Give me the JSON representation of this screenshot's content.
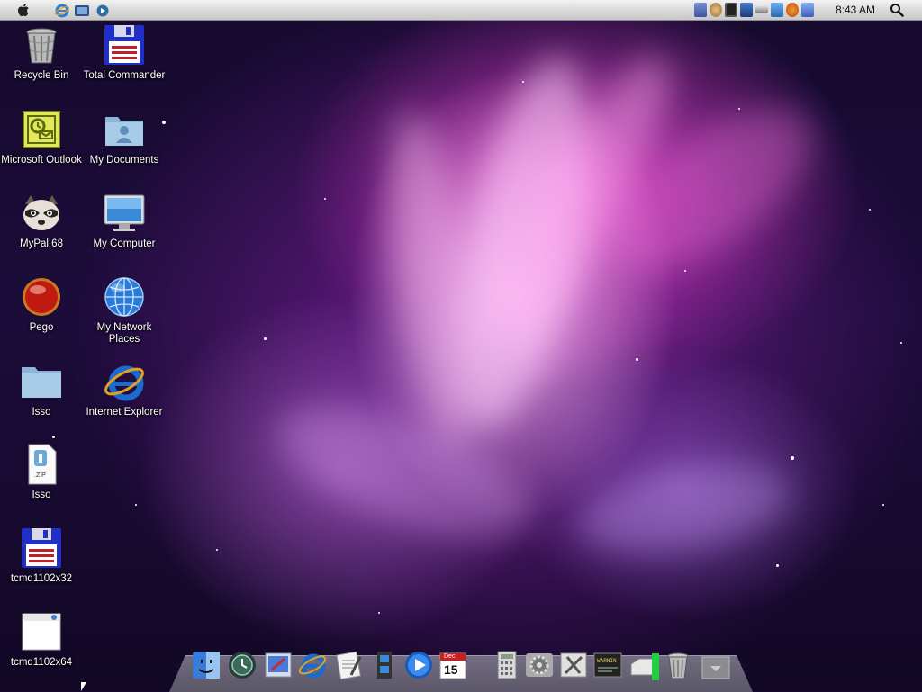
{
  "menubar": {
    "apple": "",
    "clock": "8:43 AM"
  },
  "desktop": {
    "icons": [
      {
        "label": "Recycle Bin",
        "icon": "trash-icon"
      },
      {
        "label": "Total Commander",
        "icon": "floppy-icon"
      },
      {
        "label": "Microsoft Outlook",
        "icon": "outlook-icon"
      },
      {
        "label": "My Documents",
        "icon": "user-folder-icon"
      },
      {
        "label": "MyPal 68",
        "icon": "raccoon-icon"
      },
      {
        "label": "My Computer",
        "icon": "monitor-icon"
      },
      {
        "label": "Pego",
        "icon": "red-orb-icon"
      },
      {
        "label": "My Network Places",
        "icon": "globe-icon"
      },
      {
        "label": "Isso",
        "icon": "folder-icon"
      },
      {
        "label": "Internet Explorer",
        "icon": "ie-icon"
      },
      {
        "label": "Isso",
        "icon": "zip-icon"
      },
      {
        "label": "tcmd1102x32",
        "icon": "floppy-icon"
      },
      {
        "label": "tcmd1102x64",
        "icon": "app-window-icon"
      }
    ]
  },
  "dock": {
    "calendar_month": "Dec",
    "calendar_day": "15",
    "console_text": "WARNIN"
  },
  "colors": {
    "menubar_top": "#f2f2f2",
    "wallpaper_accent": "#e040c8",
    "label_text": "#ffffff"
  }
}
